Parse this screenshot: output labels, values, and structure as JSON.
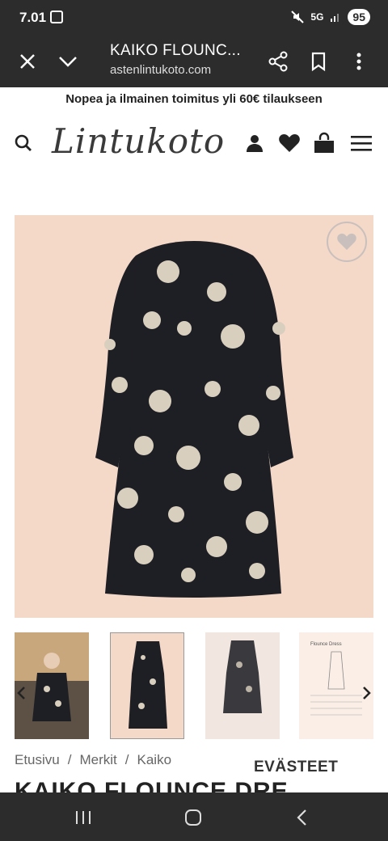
{
  "status_bar": {
    "time": "7.01",
    "battery": "95",
    "network": "5G"
  },
  "browser": {
    "title": "KAIKO FLOUNC...",
    "url": "astenlintukoto.com"
  },
  "promo": {
    "text": "Nopea ja ilmainen toimitus yli 60€ tilaukseen"
  },
  "header": {
    "logo": "Lintukoto"
  },
  "breadcrumb": {
    "items": [
      "Etusivu",
      "Merkit",
      "Kaiko"
    ],
    "separator": "/"
  },
  "cookie_label": "EVÄSTEET",
  "product": {
    "title": "KAIKO FLOUNCE DRE"
  },
  "thumbnail_3": {
    "heading": "Flounce Dress"
  },
  "colors": {
    "bar": "#2c2c2c",
    "product_bg": "#f4d8c8",
    "dress": "#1e1f24",
    "flower": "#d9cfbe"
  }
}
